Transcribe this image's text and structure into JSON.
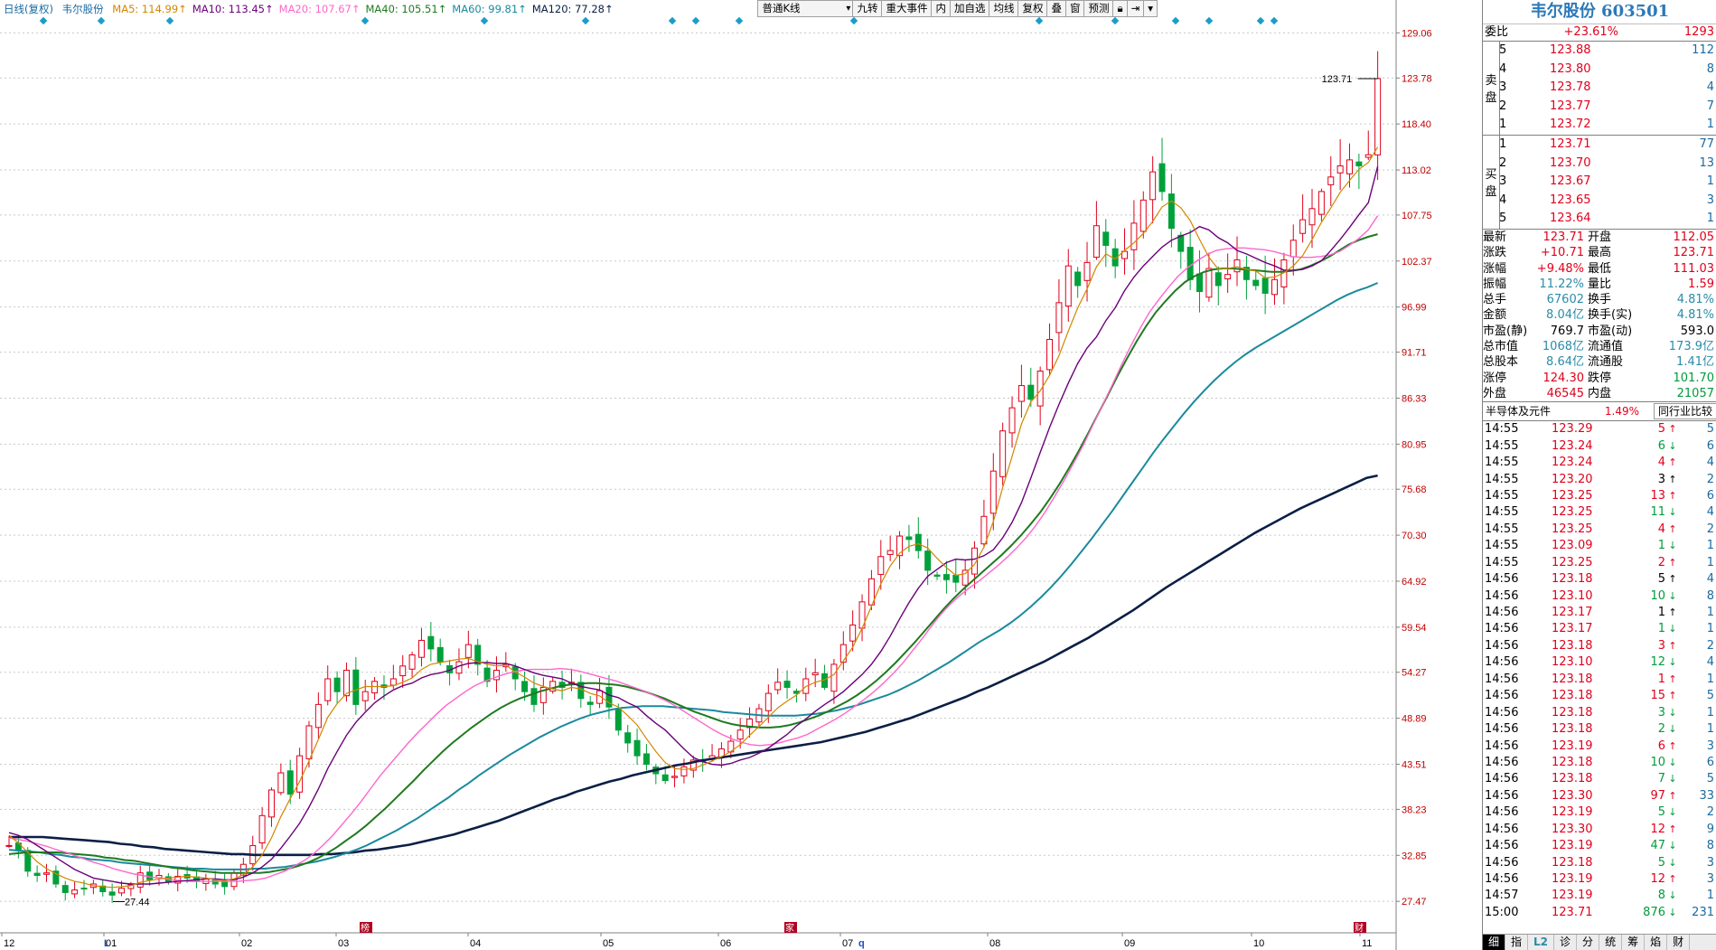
{
  "header": {
    "period": "日线(复权)",
    "stock_name": "韦尔股份",
    "ma": [
      {
        "label": "MA5: 114.99↑",
        "color": "#d28700"
      },
      {
        "label": "MA10: 113.45↑",
        "color": "#6b007a"
      },
      {
        "label": "MA20: 107.67↑",
        "color": "#ff66cc"
      },
      {
        "label": "MA40: 105.51↑",
        "color": "#1f7a1f"
      },
      {
        "label": "MA60: 99.81↑",
        "color": "#1a8a9c"
      },
      {
        "label": "MA120: 77.28↑",
        "color": "#0b1f45"
      }
    ]
  },
  "toolbar": {
    "kline_select": "普通K线",
    "buttons": [
      "九转",
      "重大事件",
      "内",
      "加自选",
      "均线",
      "复权",
      "叠",
      "窗",
      "预测"
    ],
    "lock_icon": "lock-icon",
    "nav_icon": "skip-right-icon",
    "menu_icon": "dropdown-icon"
  },
  "chart_data": {
    "type": "candlestick",
    "y_axis_ticks": [
      "129.06",
      "123.78",
      "118.40",
      "113.02",
      "107.75",
      "102.37",
      "96.99",
      "91.71",
      "86.33",
      "80.95",
      "75.68",
      "70.30",
      "64.92",
      "59.54",
      "54.27",
      "48.89",
      "43.51",
      "38.23",
      "32.85",
      "27.47"
    ],
    "ylim": [
      24.0,
      131.0
    ],
    "x_axis_labels": [
      "12",
      "01",
      "02",
      "03",
      "04",
      "05",
      "06",
      "07",
      "08",
      "09",
      "10",
      "11"
    ],
    "current_price_label": "123.71",
    "low_label": "27.44",
    "markers": [
      "L",
      "q"
    ],
    "event_marks": [
      "榜",
      "家",
      "财"
    ],
    "close_path": [
      34,
      33.5,
      31,
      30.5,
      30.8,
      29.5,
      28.5,
      28.8,
      29,
      29.5,
      28.6,
      28.2,
      29,
      29.4,
      30.8,
      30,
      30.5,
      29.8,
      30.4,
      30.2,
      29.8,
      30.1,
      29.5,
      29.2,
      30.8,
      31.8,
      34,
      37.5,
      40.5,
      42.5,
      40,
      44.5,
      48,
      50.5,
      53.5,
      52,
      54.5,
      50.5,
      52,
      53.2,
      52.5,
      53.5,
      55,
      56.3,
      58,
      57,
      55.5,
      54.2,
      55.5,
      57.5,
      55.2,
      53.2,
      54.5,
      55.2,
      53.5,
      52,
      50.5,
      52.5,
      53.2,
      52.5,
      53.1,
      51.2,
      50.5,
      52.1,
      50.2,
      47.5,
      46,
      44.5,
      43.5,
      42.4,
      41.6,
      42.1,
      43.2,
      44,
      43.8,
      44.5,
      45.3,
      46.2,
      47.5,
      48.8,
      50,
      51.8,
      53.1,
      52.5,
      51.8,
      53.5,
      54.2,
      52.5,
      55.2,
      57.5,
      59.8,
      62.5,
      65.2,
      67.8,
      68.5,
      70.2,
      69.8,
      68.5,
      66.2,
      65.5,
      65.1,
      64.8,
      66.2,
      68.8,
      72.5,
      77.8,
      82.5,
      85.2,
      87.8,
      86.2,
      89.5,
      93.2,
      97.5,
      101.8,
      99.5,
      102.2,
      106.5,
      104.2,
      101.8,
      103.5,
      106.8,
      109.5,
      112.8,
      110.5,
      106.2,
      103.5,
      100.2,
      98.8,
      101.5,
      99.5,
      100.8,
      102.5,
      100.2,
      99.5,
      98.6,
      100.2,
      102.5,
      104.8,
      107.2,
      108.5,
      110.5,
      112.2,
      113.5,
      114.2,
      113.5,
      114.8,
      123.71
    ],
    "ma5": [
      35.2,
      34.3,
      33.2,
      32.1,
      31.3,
      30.7,
      30.2,
      29.8,
      29.6,
      29.3,
      29.2,
      29.1,
      29.2,
      29.3,
      29.7,
      29.9,
      30.1,
      30.2,
      30.3,
      30.4,
      30.3,
      30.2,
      30,
      29.9,
      30.1,
      30.6,
      31.5,
      32.9,
      34.9,
      37.4,
      39.5,
      41.5,
      43.9,
      46.4,
      49,
      50.6,
      51.8,
      52.2,
      52.6,
      52.6,
      52.6,
      52.7,
      53.1,
      53.6,
      54.6,
      55.2,
      55.4,
      55.6,
      55.8,
      55.9,
      55.5,
      55.2,
      55,
      55.1,
      54.3,
      53.7,
      53,
      52.6,
      52.3,
      52.1,
      52.5,
      52.3,
      51.8,
      51.5,
      50.7,
      50.2,
      49.2,
      48.1,
      46.5,
      45,
      43.7,
      43,
      42.9,
      43,
      43.4,
      43.9,
      44.4,
      45,
      45.8,
      46.9,
      47.9,
      49,
      50.1,
      50.9,
      51.6,
      52.6,
      53.1,
      53.4,
      54,
      55.6,
      57.2,
      59.4,
      62,
      64.6,
      66.7,
      68.2,
      69,
      69.3,
      68.8,
      67.6,
      66.5,
      65.6,
      65.8,
      66.9,
      68.9,
      71.9,
      75.9,
      79.5,
      83.3,
      85.9,
      87.2,
      89,
      91.3,
      94.2,
      96.9,
      99.1,
      101.7,
      103.2,
      102.6,
      103.6,
      104.5,
      105.6,
      107,
      108.7,
      109.4,
      108.6,
      107.1,
      104.9,
      102.8,
      101.4,
      101.5,
      101.7,
      101.4,
      101.2,
      100.4,
      100.5,
      101,
      101.8,
      103,
      104.9,
      106.9,
      108.6,
      110.4,
      111.8,
      113.1,
      113.9,
      115.7
    ],
    "ma10": [
      35.5,
      35.2,
      34.7,
      34,
      33.3,
      32.6,
      31.9,
      31.2,
      30.7,
      30.2,
      30.0,
      29.8,
      29.6,
      29.5,
      29.5,
      29.5,
      29.6,
      29.7,
      29.8,
      29.9,
      30.0,
      30.1,
      30.1,
      30.0,
      30.0,
      30.3,
      30.8,
      31.5,
      32.4,
      33.7,
      35.1,
      36.6,
      38.5,
      40.6,
      43.0,
      45.0,
      46.9,
      48.4,
      49.6,
      50.7,
      51.5,
      52.2,
      52.7,
      53.0,
      53.6,
      54.0,
      54.2,
      54.5,
      55.0,
      55.3,
      55.4,
      55.4,
      55.3,
      55.3,
      55.0,
      54.6,
      54.2,
      53.9,
      53.7,
      53.5,
      53.0,
      52.6,
      52.4,
      52.2,
      51.6,
      51.3,
      50.7,
      50.2,
      49.2,
      48.3,
      47.5,
      46.4,
      45.3,
      44.3,
      43.8,
      43.5,
      43.4,
      43.6,
      44.0,
      44.3,
      44.8,
      45.4,
      46.2,
      47.0,
      48.0,
      48.8,
      49.7,
      50.5,
      51.2,
      52.0,
      53.0,
      54.0,
      55.2,
      56.7,
      58.5,
      60.5,
      62.4,
      64.1,
      65.5,
      66.3,
      67.1,
      67.5,
      67.4,
      67.5,
      67.9,
      68.6,
      70.0,
      71.8,
      74.1,
      77.0,
      80.0,
      82.9,
      85.6,
      88.1,
      90.4,
      92.2,
      93.5,
      95.4,
      96.9,
      98.9,
      100.5,
      101.8,
      102.9,
      104.0,
      104.8,
      105.3,
      105.7,
      106.4,
      106.0,
      105.1,
      104.5,
      103.6,
      103.2,
      102.7,
      102.2,
      101.8,
      101.3,
      101.3,
      101.4,
      101.8,
      102.4,
      103.6,
      104.9,
      106.3,
      107.8,
      109.2,
      113.45
    ],
    "ma20": [
      34.9,
      34.7,
      34.5,
      34.2,
      33.9,
      33.5,
      33.2,
      32.8,
      32.4,
      32.0,
      31.7,
      31.3,
      31.0,
      30.7,
      30.5,
      30.3,
      30.2,
      30.0,
      29.9,
      29.8,
      29.8,
      29.8,
      29.8,
      29.8,
      29.8,
      29.9,
      30.0,
      30.2,
      30.6,
      31.0,
      31.6,
      32.2,
      33.0,
      34.0,
      35.1,
      36.4,
      37.7,
      39.1,
      40.6,
      42.1,
      43.4,
      44.7,
      46.0,
      47.2,
      48.3,
      49.4,
      50.4,
      51.2,
      52.0,
      52.7,
      53.2,
      53.6,
      54.0,
      54.3,
      54.5,
      54.6,
      54.6,
      54.6,
      54.7,
      54.6,
      54.4,
      54.1,
      53.8,
      53.5,
      53.2,
      52.8,
      52.4,
      52.0,
      51.5,
      51.0,
      50.4,
      49.7,
      49.0,
      48.3,
      47.6,
      47.0,
      46.5,
      46.1,
      45.8,
      45.7,
      45.8,
      46.0,
      46.3,
      46.6,
      47.0,
      47.6,
      48.2,
      48.8,
      49.5,
      50.3,
      51.1,
      52.0,
      53.0,
      54.1,
      55.3,
      56.7,
      58.1,
      59.6,
      61.0,
      62.2,
      63.2,
      64.1,
      64.9,
      65.8,
      66.7,
      67.7,
      68.8,
      70.0,
      71.4,
      73.0,
      74.8,
      76.7,
      78.7,
      80.8,
      83.1,
      85.4,
      87.7,
      90.1,
      92.4,
      94.5,
      96.4,
      97.9,
      99.3,
      100.6,
      101.6,
      102.4,
      103.1,
      103.6,
      103.8,
      103.9,
      103.9,
      103.8,
      103.7,
      103.5,
      103.2,
      102.9,
      102.8,
      102.8,
      102.9,
      103.1,
      103.5,
      104.2,
      105.0,
      106.0,
      107.67
    ],
    "ma40": [
      33,
      33.1,
      33.2,
      33.2,
      33.2,
      33.2,
      33.1,
      33,
      32.9,
      32.8,
      32.6,
      32.5,
      32.3,
      32.2,
      32,
      31.8,
      31.6,
      31.4,
      31.3,
      31.1,
      31,
      30.9,
      30.8,
      30.8,
      30.8,
      30.8,
      30.8,
      30.9,
      31.1,
      31.3,
      31.6,
      32,
      32.5,
      33.1,
      33.8,
      34.6,
      35.4,
      36.3,
      37.3,
      38.3,
      39.4,
      40.5,
      41.6,
      42.8,
      43.9,
      45,
      46,
      46.9,
      47.8,
      48.6,
      49.4,
      50.1,
      50.7,
      51.2,
      51.6,
      52,
      52.3,
      52.6,
      52.8,
      52.9,
      53,
      53,
      52.9,
      52.8,
      52.6,
      52.3,
      52,
      51.6,
      51.2,
      50.7,
      50.2,
      49.7,
      49.3,
      48.9,
      48.5,
      48.2,
      48,
      47.9,
      47.8,
      47.8,
      47.9,
      48.1,
      48.4,
      48.8,
      49.2,
      49.7,
      50.3,
      50.9,
      51.6,
      52.4,
      53.3,
      54.3,
      55.4,
      56.6,
      57.8,
      59.1,
      60.4,
      61.7,
      62.9,
      64,
      65,
      66,
      67,
      68,
      69.1,
      70.3,
      71.6,
      73,
      74.6,
      76.3,
      78.2,
      80.2,
      82.3,
      84.5,
      86.7,
      88.9,
      91,
      93,
      94.8,
      96.4,
      97.7,
      98.9,
      99.9,
      100.6,
      101.1,
      101.4,
      101.5,
      101.5,
      101.4,
      101.3,
      101.2,
      101.1,
      101.1,
      101.2,
      101.4,
      101.8,
      102.3,
      102.9,
      103.6,
      104.3,
      104.8,
      105.2,
      105.51
    ],
    "ma60": [
      33.5,
      33.4,
      33.3,
      33.2,
      33,
      32.9,
      32.7,
      32.6,
      32.4,
      32.3,
      32.2,
      32,
      31.9,
      31.8,
      31.7,
      31.6,
      31.5,
      31.4,
      31.3,
      31.3,
      31.2,
      31.2,
      31.2,
      31.2,
      31.3,
      31.3,
      31.4,
      31.5,
      31.7,
      31.9,
      32.1,
      32.4,
      32.7,
      33.1,
      33.5,
      34,
      34.6,
      35.2,
      35.8,
      36.5,
      37.2,
      38,
      38.8,
      39.6,
      40.5,
      41.3,
      42.2,
      43,
      43.8,
      44.6,
      45.3,
      46,
      46.7,
      47.3,
      47.9,
      48.4,
      48.9,
      49.3,
      49.6,
      49.9,
      50.1,
      50.2,
      50.3,
      50.3,
      50.3,
      50.2,
      50.1,
      50,
      49.9,
      49.8,
      49.6,
      49.5,
      49.4,
      49.3,
      49.2,
      49.2,
      49.2,
      49.2,
      49.3,
      49.4,
      49.6,
      49.8,
      50.1,
      50.4,
      50.8,
      51.2,
      51.6,
      52.1,
      52.7,
      53.3,
      54,
      54.7,
      55.4,
      56.2,
      57,
      57.8,
      58.5,
      59.2,
      60,
      60.9,
      61.9,
      63,
      64.2,
      65.5,
      66.9,
      68.4,
      69.9,
      71.5,
      73.1,
      74.8,
      76.5,
      78.2,
      79.9,
      81.5,
      83,
      84.5,
      85.9,
      87.2,
      88.4,
      89.5,
      90.5,
      91.4,
      92.2,
      92.9,
      93.6,
      94.3,
      95,
      95.7,
      96.4,
      97.1,
      97.8,
      98.4,
      98.9,
      99.3,
      99.81
    ],
    "ma120": [
      35,
      35,
      35,
      35,
      34.9,
      34.8,
      34.7,
      34.6,
      34.5,
      34.4,
      34.2,
      34.1,
      33.9,
      33.8,
      33.6,
      33.5,
      33.4,
      33.3,
      33.2,
      33.1,
      33,
      33,
      32.9,
      32.9,
      32.9,
      32.9,
      32.9,
      32.9,
      33,
      33,
      33.1,
      33.2,
      33.4,
      33.5,
      33.7,
      33.9,
      34.1,
      34.4,
      34.7,
      35,
      35.3,
      35.7,
      36.1,
      36.5,
      36.9,
      37.4,
      37.9,
      38.4,
      38.9,
      39.4,
      39.8,
      40.3,
      40.7,
      41.1,
      41.5,
      41.8,
      42.2,
      42.5,
      42.8,
      43.1,
      43.4,
      43.6,
      43.9,
      44.1,
      44.3,
      44.5,
      44.7,
      44.9,
      45.1,
      45.3,
      45.5,
      45.7,
      45.9,
      46.1,
      46.4,
      46.7,
      47,
      47.3,
      47.7,
      48.1,
      48.5,
      48.9,
      49.4,
      49.9,
      50.4,
      50.9,
      51.4,
      52,
      52.5,
      53.1,
      53.7,
      54.3,
      54.9,
      55.5,
      56.2,
      56.9,
      57.6,
      58.3,
      59.1,
      59.9,
      60.7,
      61.5,
      62.4,
      63.3,
      64.2,
      65,
      65.8,
      66.6,
      67.4,
      68.2,
      69,
      69.8,
      70.6,
      71.3,
      72,
      72.7,
      73.4,
      74,
      74.6,
      75.2,
      75.8,
      76.4,
      77,
      77.28
    ]
  },
  "panel": {
    "title": "韦尔股份 603501",
    "weibi": {
      "label": "委比",
      "pct": "+23.61%",
      "val": "1293"
    },
    "sell_label": [
      "卖",
      "盘"
    ],
    "buy_label": [
      "买",
      "盘"
    ],
    "sells": [
      {
        "lv": "5",
        "p": "123.88",
        "v": "112"
      },
      {
        "lv": "4",
        "p": "123.80",
        "v": "8"
      },
      {
        "lv": "3",
        "p": "123.78",
        "v": "4"
      },
      {
        "lv": "2",
        "p": "123.77",
        "v": "7"
      },
      {
        "lv": "1",
        "p": "123.72",
        "v": "1"
      }
    ],
    "buys": [
      {
        "lv": "1",
        "p": "123.71",
        "v": "77"
      },
      {
        "lv": "2",
        "p": "123.70",
        "v": "13"
      },
      {
        "lv": "3",
        "p": "123.67",
        "v": "1"
      },
      {
        "lv": "4",
        "p": "123.65",
        "v": "3"
      },
      {
        "lv": "5",
        "p": "123.64",
        "v": "1"
      }
    ],
    "quote": [
      [
        "最新",
        "123.71",
        "red",
        "开盘",
        "112.05",
        "red"
      ],
      [
        "涨跌",
        "+10.71",
        "red",
        "最高",
        "123.71",
        "red"
      ],
      [
        "涨幅",
        "+9.48%",
        "red",
        "最低",
        "111.03",
        "red"
      ],
      [
        "振幅",
        "11.22%",
        "teal",
        "量比",
        "1.59",
        "red"
      ],
      [
        "总手",
        "67602",
        "teal",
        "换手",
        "4.81%",
        "teal"
      ],
      [
        "金额",
        "8.04亿",
        "teal",
        "换手(实)",
        "4.81%",
        "teal"
      ],
      [
        "市盈(静)",
        "769.7",
        "black",
        "市盈(动)",
        "593.0",
        "black"
      ],
      [
        "总市值",
        "1068亿",
        "teal",
        "流通值",
        "173.9亿",
        "teal"
      ],
      [
        "总股本",
        "8.64亿",
        "teal",
        "流通股",
        "1.41亿",
        "teal"
      ],
      [
        "涨停",
        "124.30",
        "red",
        "跌停",
        "101.70",
        "green"
      ],
      [
        "外盘",
        "46545",
        "red",
        "内盘",
        "21057",
        "green"
      ]
    ],
    "sector": {
      "name": "半导体及元件",
      "pct": "1.49%",
      "btn": "同行业比较"
    },
    "ticks": [
      [
        "14:55",
        "123.29",
        "5",
        "up",
        "5"
      ],
      [
        "14:55",
        "123.24",
        "6",
        "dn",
        "6"
      ],
      [
        "14:55",
        "123.24",
        "4",
        "up",
        "4"
      ],
      [
        "14:55",
        "123.20",
        "3",
        "bk",
        "2"
      ],
      [
        "14:55",
        "123.25",
        "13",
        "up",
        "6"
      ],
      [
        "14:55",
        "123.25",
        "11",
        "dn",
        "4"
      ],
      [
        "14:55",
        "123.25",
        "4",
        "up",
        "2"
      ],
      [
        "14:55",
        "123.09",
        "1",
        "dn",
        "1"
      ],
      [
        "14:55",
        "123.25",
        "2",
        "up",
        "1"
      ],
      [
        "14:56",
        "123.18",
        "5",
        "bk",
        "4"
      ],
      [
        "14:56",
        "123.10",
        "10",
        "dn",
        "8"
      ],
      [
        "14:56",
        "123.17",
        "1",
        "bk",
        "1"
      ],
      [
        "14:56",
        "123.17",
        "1",
        "dn",
        "1"
      ],
      [
        "14:56",
        "123.18",
        "3",
        "up",
        "2"
      ],
      [
        "14:56",
        "123.10",
        "12",
        "dn",
        "4"
      ],
      [
        "14:56",
        "123.18",
        "1",
        "up",
        "1"
      ],
      [
        "14:56",
        "123.18",
        "15",
        "up",
        "5"
      ],
      [
        "14:56",
        "123.18",
        "3",
        "dn",
        "1"
      ],
      [
        "14:56",
        "123.18",
        "2",
        "dn",
        "1"
      ],
      [
        "14:56",
        "123.19",
        "6",
        "up",
        "3"
      ],
      [
        "14:56",
        "123.18",
        "10",
        "dn",
        "6"
      ],
      [
        "14:56",
        "123.18",
        "7",
        "dn",
        "5"
      ],
      [
        "14:56",
        "123.30",
        "97",
        "up",
        "33"
      ],
      [
        "14:56",
        "123.19",
        "5",
        "dn",
        "2"
      ],
      [
        "14:56",
        "123.30",
        "12",
        "up",
        "9"
      ],
      [
        "14:56",
        "123.19",
        "47",
        "dn",
        "8"
      ],
      [
        "14:56",
        "123.18",
        "5",
        "dn",
        "3"
      ],
      [
        "14:56",
        "123.19",
        "12",
        "up",
        "3"
      ],
      [
        "14:57",
        "123.19",
        "8",
        "dn",
        "1"
      ],
      [
        "15:00",
        "123.71",
        "876",
        "dn",
        "231"
      ]
    ],
    "tabs": [
      "细",
      "指",
      "L2",
      "诊",
      "分",
      "统",
      "筹",
      "焰",
      "财"
    ]
  }
}
